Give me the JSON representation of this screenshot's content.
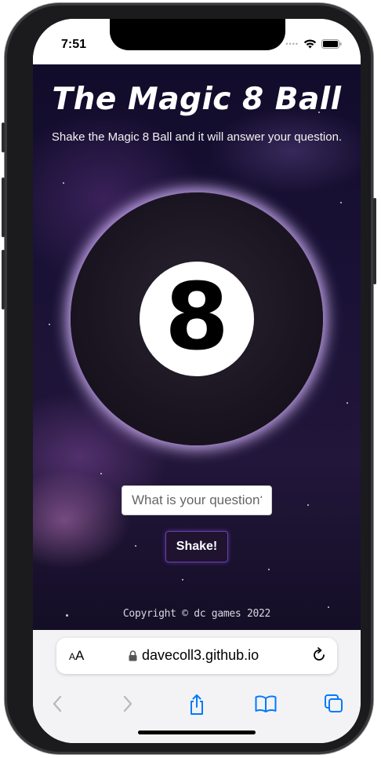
{
  "status_bar": {
    "time": "7:51"
  },
  "page": {
    "title": "The Magic 8 Ball",
    "subtitle": "Shake the Magic 8 Ball and it will answer your question.",
    "ball_number": "8",
    "question_placeholder": "What is your question?",
    "shake_label": "Shake!",
    "copyright": "Copyright © dc games 2022"
  },
  "browser": {
    "text_size_label": "AA",
    "url": "davecoll3.github.io",
    "icons": [
      "text-size-icon",
      "lock-icon",
      "reload-icon",
      "back-icon",
      "forward-icon",
      "share-icon",
      "bookmarks-icon",
      "tabs-icon"
    ]
  },
  "colors": {
    "accent": "#007aff",
    "button_bg": "#1f1330",
    "button_border": "#6a3fb0",
    "ball_glow": "#d2aaff"
  }
}
